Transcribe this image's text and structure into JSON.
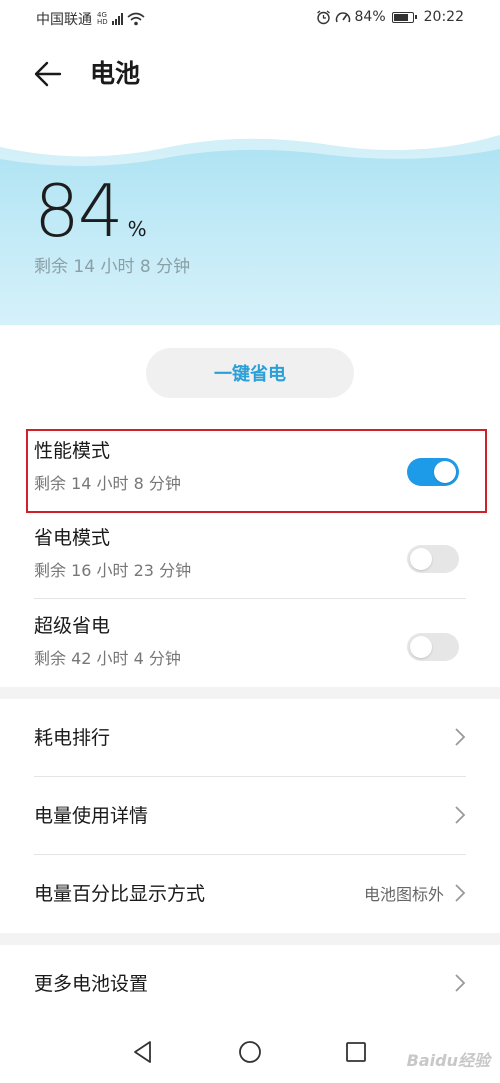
{
  "status_bar": {
    "carrier": "中国联通",
    "net_badge_top": "4G",
    "net_badge_bottom": "HD",
    "battery_pct": "84%",
    "battery_level": 0.84,
    "time": "20:22"
  },
  "header": {
    "title": "电池"
  },
  "hero": {
    "percent": "84",
    "percent_sign": "%",
    "remaining": "剩余 14 小时 8 分钟"
  },
  "one_key_button": "一键省电",
  "modes": [
    {
      "title": "性能模式",
      "sub": "剩余 14 小时 8 分钟",
      "on": true
    },
    {
      "title": "省电模式",
      "sub": "剩余 16 小时 23 分钟",
      "on": false
    },
    {
      "title": "超级省电",
      "sub": "剩余 42 小时 4 分钟",
      "on": false
    }
  ],
  "menu": [
    {
      "label": "耗电排行",
      "value": ""
    },
    {
      "label": "电量使用详情",
      "value": ""
    },
    {
      "label": "电量百分比显示方式",
      "value": "电池图标外"
    }
  ],
  "more": {
    "label": "更多电池设置"
  },
  "watermark": "Baidu经验",
  "colors": {
    "accent": "#1e9be8",
    "highlight": "#d0202a",
    "button_text": "#2a9fd8"
  }
}
